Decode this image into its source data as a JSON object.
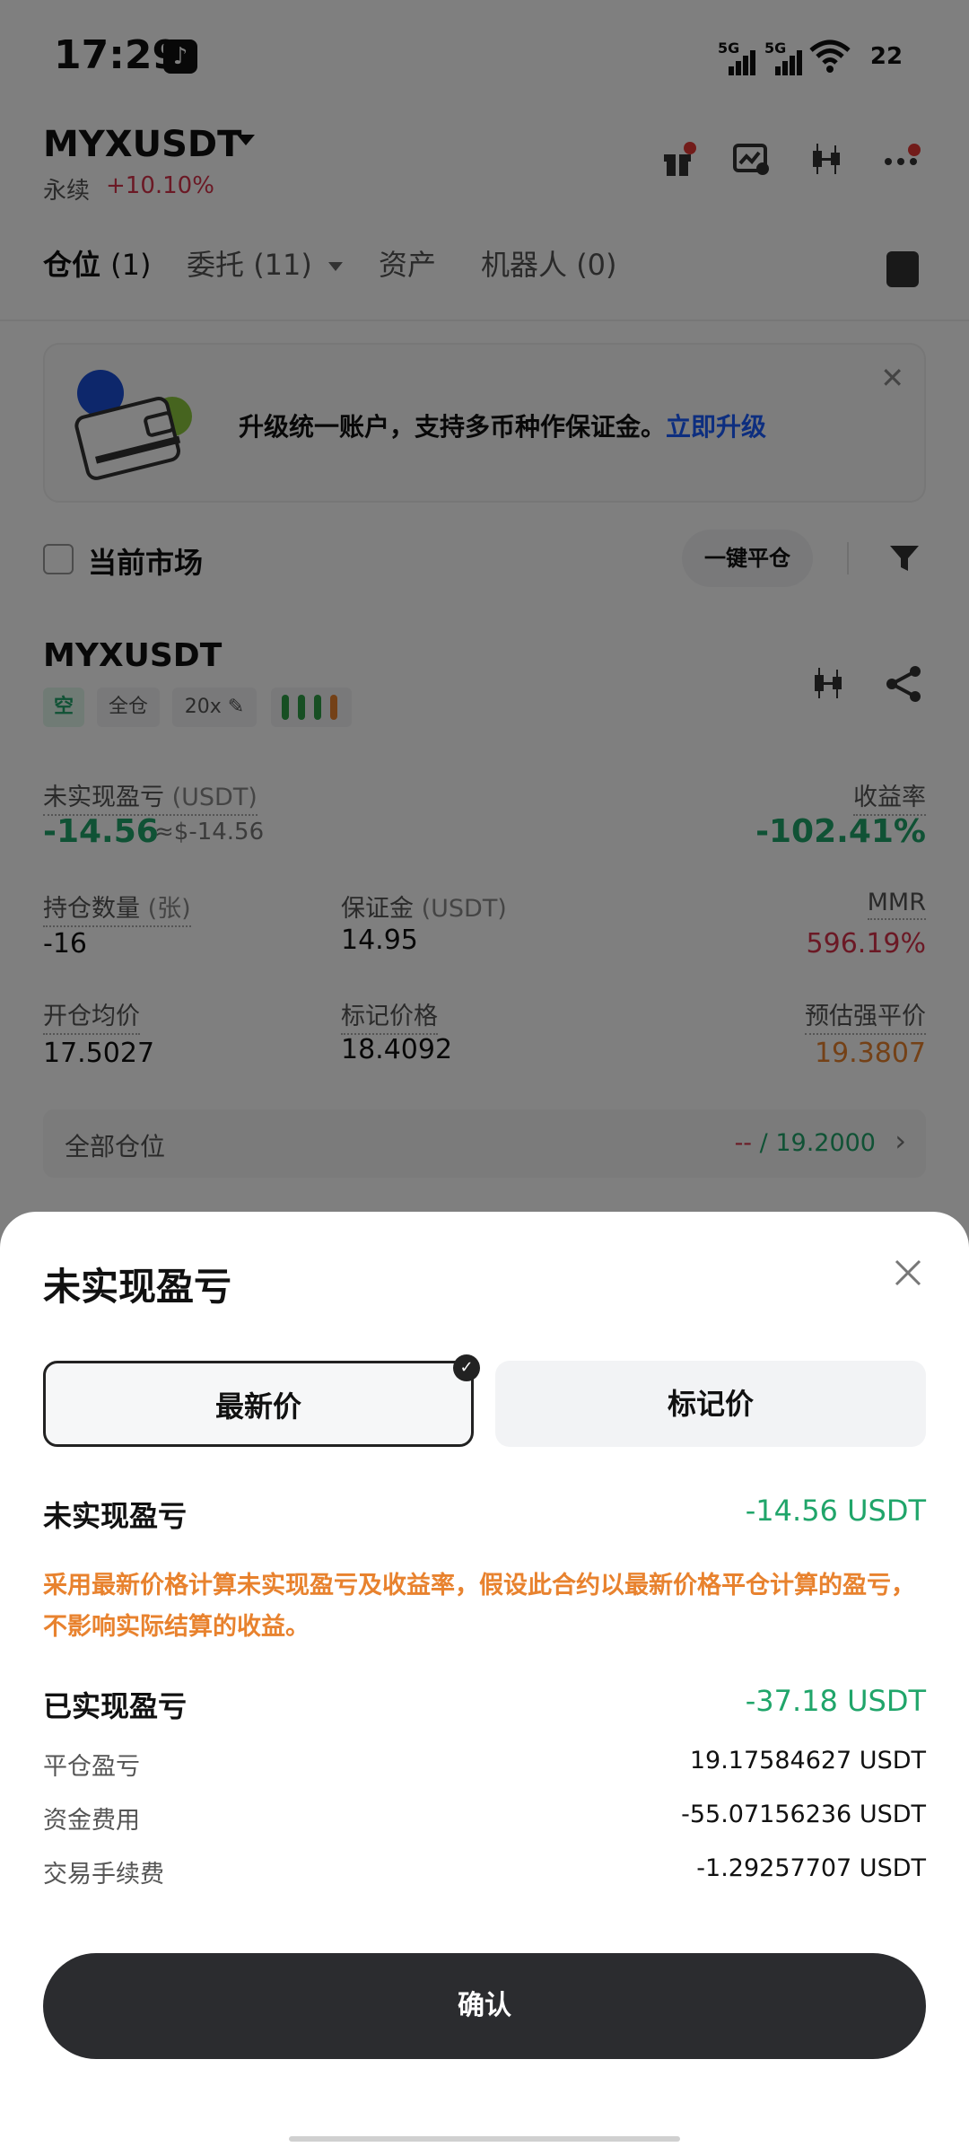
{
  "status_bar": {
    "time": "17:29",
    "sig1": "5G",
    "sig2": "5G",
    "battery": "22"
  },
  "header": {
    "pair": "MYXUSDT",
    "perp_label": "永续",
    "change": "+10.10%"
  },
  "tabs": [
    {
      "label": "仓位",
      "count": "(1)"
    },
    {
      "label": "委托",
      "count": "(11)"
    },
    {
      "label": "资产",
      "count": ""
    },
    {
      "label": "机器人",
      "count": "(0)"
    }
  ],
  "banner": {
    "text": "升级统一账户，支持多币种作保证金。",
    "link": "立即升级"
  },
  "filter_row": {
    "current_market": "当前市场",
    "close_all": "一键平仓"
  },
  "position": {
    "symbol": "MYXUSDT",
    "tags": {
      "side": "空",
      "mode": "全仓",
      "leverage": "20x ✎"
    },
    "unrealized_label": "未实现盈亏",
    "unrealized_unit": "(USDT)",
    "unrealized_value": "-14.56",
    "unrealized_approx": "≈$-14.56",
    "roe_label": "收益率",
    "roe_value": "-102.41%",
    "qty_label": "持仓数量",
    "qty_unit": "(张)",
    "qty_value": "-16",
    "margin_label": "保证金",
    "margin_unit": "(USDT)",
    "margin_value": "14.95",
    "mmr_label": "MMR",
    "mmr_value": "596.19%",
    "entry_label": "开仓均价",
    "entry_value": "17.5027",
    "mark_label": "标记价格",
    "mark_value": "18.4092",
    "liq_label": "预估强平价",
    "liq_value": "19.3807",
    "all_positions": "全部仓位",
    "tp_sl_red": "--",
    "tp_sl_green": "/ 19.2000"
  },
  "sheet": {
    "title": "未实现盈亏",
    "seg_latest": "最新价",
    "seg_mark": "标记价",
    "unrealized_label": "未实现盈亏",
    "unrealized_value": "-14.56 USDT",
    "note": "采用最新价格计算未实现盈亏及收益率，假设此合约以最新价格平仓计算的盈亏，不影响实际结算的收益。",
    "realized_label": "已实现盈亏",
    "realized_value": "-37.18 USDT",
    "details": [
      {
        "label": "平仓盈亏",
        "value": "19.17584627 USDT"
      },
      {
        "label": "资金费用",
        "value": "-55.07156236 USDT"
      },
      {
        "label": "交易手续费",
        "value": "-1.29257707 USDT"
      }
    ],
    "confirm": "确认"
  },
  "colors": {
    "green": "#20a56a",
    "red": "#d6334a",
    "orange": "#e8822e",
    "link": "#1a5cff",
    "button": "#2b2c2f"
  }
}
